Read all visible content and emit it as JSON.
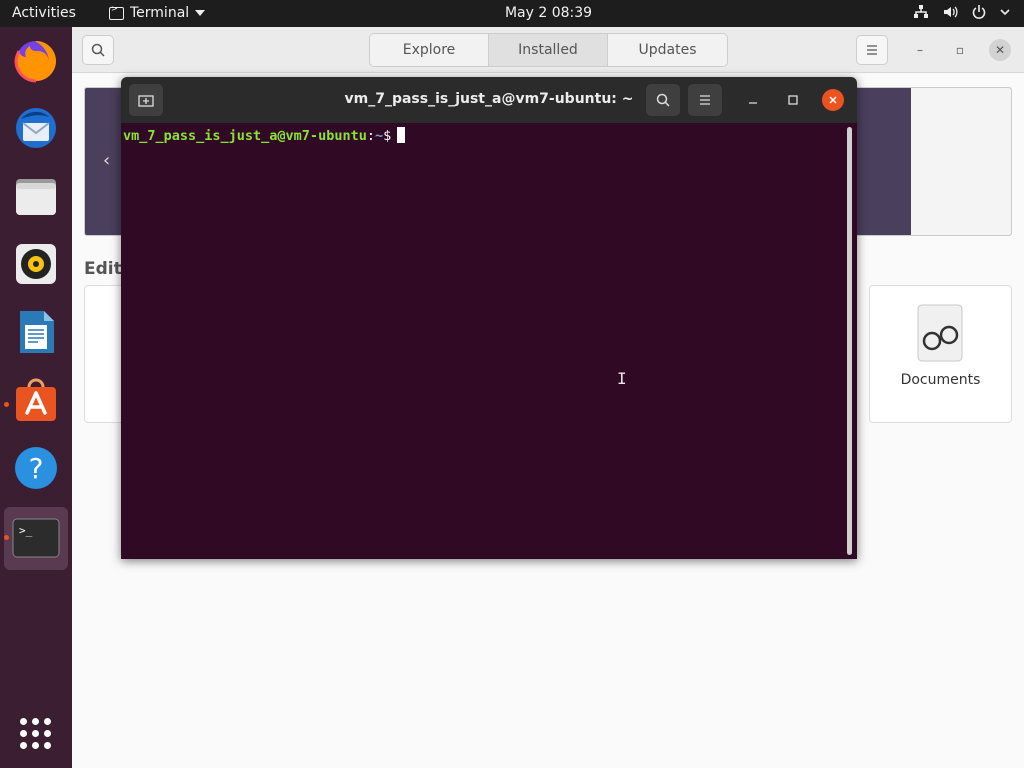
{
  "topbar": {
    "activities": "Activities",
    "app_name": "Terminal",
    "clock": "May 2  08:39",
    "icons": [
      "network-icon",
      "volume-icon",
      "power-icon",
      "chevron-down-icon"
    ]
  },
  "dock": {
    "items": [
      {
        "name": "firefox",
        "icon": "firefox-icon"
      },
      {
        "name": "thunderbird",
        "icon": "thunderbird-icon"
      },
      {
        "name": "files",
        "icon": "files-icon"
      },
      {
        "name": "rhythmbox",
        "icon": "rhythmbox-icon"
      },
      {
        "name": "libreoffice-writer",
        "icon": "writer-icon"
      },
      {
        "name": "ubuntu-software",
        "icon": "software-icon"
      },
      {
        "name": "help",
        "icon": "help-icon"
      },
      {
        "name": "terminal",
        "icon": "terminal-icon"
      }
    ],
    "show_apps_icon": "apps-grid-icon"
  },
  "software": {
    "tabs": [
      "Explore",
      "Installed",
      "Updates"
    ],
    "active_tab": "Installed",
    "section_label": "Edit",
    "card_label": "Documents"
  },
  "terminal": {
    "title": "vm_7_pass_is_just_a@vm7-ubuntu: ~",
    "prompt_user": "vm_7_pass_is_just_a@vm7-ubuntu",
    "prompt_colon": ":",
    "prompt_path": "~",
    "prompt_symbol": "$"
  },
  "colors": {
    "terminal_bg": "#300a24",
    "prompt_user": "#8ae234",
    "prompt_path": "#729fcf",
    "accent": "#e95420",
    "dock_bg": "#3c1e33",
    "topbar_bg": "#1d1d1d"
  }
}
